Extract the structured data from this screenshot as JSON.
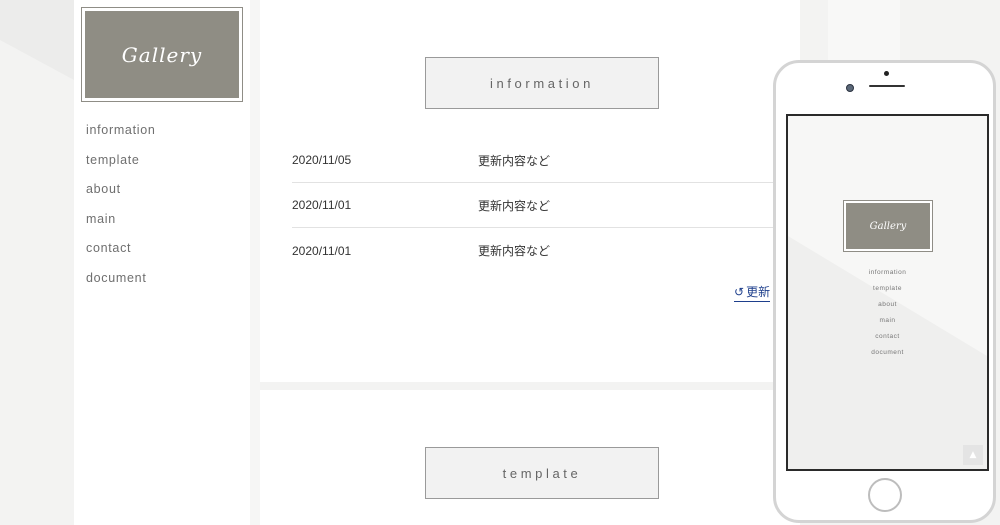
{
  "site": {
    "logo_text": "Gallery"
  },
  "sidebar": {
    "items": [
      {
        "label": "information"
      },
      {
        "label": "template"
      },
      {
        "label": "about"
      },
      {
        "label": "main"
      },
      {
        "label": "contact"
      },
      {
        "label": "document"
      }
    ]
  },
  "information": {
    "heading": "information",
    "news": [
      {
        "date": "2020/11/05",
        "text": "更新内容など"
      },
      {
        "date": "2020/11/01",
        "text": "更新内容など"
      },
      {
        "date": "2020/11/01",
        "text": "更新内容など"
      }
    ],
    "history_link": "更新"
  },
  "template": {
    "heading": "template"
  },
  "phone_preview": {
    "logo_text": "Gallery",
    "nav": [
      "information",
      "template",
      "about",
      "main",
      "contact",
      "document"
    ],
    "scroll_top_icon": "chevron-up-icon"
  },
  "colors": {
    "logo_bg": "#8f8d84",
    "link": "#1e3f8c",
    "page_bg": "#f3f3f2",
    "panel_bg": "#ffffff"
  }
}
